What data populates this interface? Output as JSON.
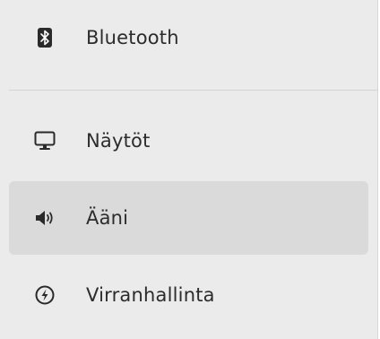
{
  "sidebar": {
    "items": [
      {
        "label": "Bluetooth",
        "icon": "bluetooth-icon",
        "selected": false
      },
      {
        "label": "Näytöt",
        "icon": "display-icon",
        "selected": false
      },
      {
        "label": "Ääni",
        "icon": "speaker-icon",
        "selected": true
      },
      {
        "label": "Virranhallinta",
        "icon": "power-icon",
        "selected": false
      }
    ]
  },
  "colors": {
    "sidebar_bg": "#ebebeb",
    "selected_bg": "#dadada",
    "text": "#2c2c2c",
    "separator": "#d4d4d4"
  }
}
